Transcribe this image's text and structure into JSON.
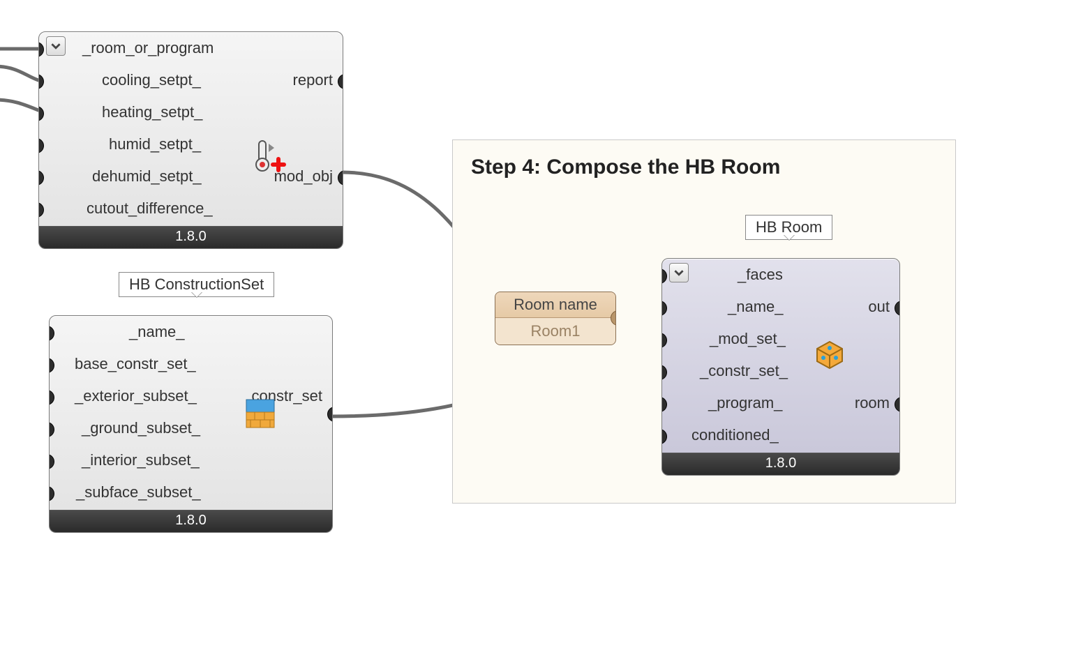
{
  "version": "1.8.0",
  "group": {
    "title": "Step 4: Compose the HB Room"
  },
  "labels": {
    "construction_set": "HB ConstructionSet",
    "hb_room": "HB Room"
  },
  "panel_room_name": {
    "header": "Room name",
    "value": "Room1"
  },
  "setpoints": {
    "inputs": [
      "_room_or_program",
      "cooling_setpt_",
      "heating_setpt_",
      "humid_setpt_",
      "dehumid_setpt_",
      "cutout_difference_"
    ],
    "outputs": [
      "report",
      "mod_obj"
    ]
  },
  "construction_set": {
    "inputs": [
      "_name_",
      "base_constr_set_",
      "_exterior_subset_",
      "_ground_subset_",
      "_interior_subset_",
      "_subface_subset_"
    ],
    "outputs": [
      "constr_set"
    ]
  },
  "hb_room": {
    "inputs": [
      "_faces",
      "_name_",
      "_mod_set_",
      "_constr_set_",
      "_program_",
      "conditioned_"
    ],
    "outputs": [
      "out",
      "room"
    ]
  }
}
